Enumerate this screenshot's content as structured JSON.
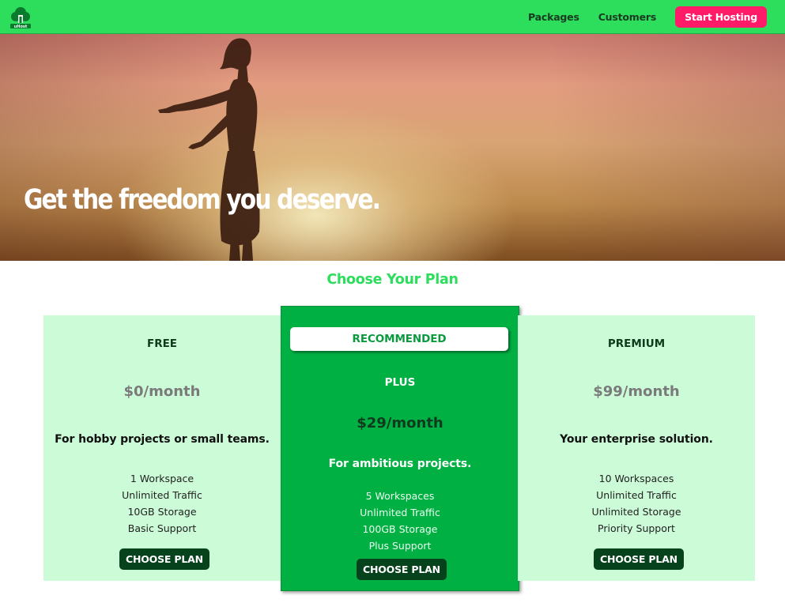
{
  "header": {
    "logo_icon": "tree-logo-icon",
    "logo_text": "uHost",
    "nav": [
      {
        "label": "Packages"
      },
      {
        "label": "Customers"
      }
    ],
    "cta_label": "Start Hosting",
    "colors": {
      "bar": "#2ddd5c",
      "cta": "#ff1b68"
    }
  },
  "hero": {
    "title": "Get the freedom you deserve."
  },
  "plans_section": {
    "title": "Choose Your Plan",
    "plans": [
      {
        "name": "FREE",
        "price": "$0/month",
        "description": "For hobby projects or small teams.",
        "features": [
          "1 Workspace",
          "Unlimited Traffic",
          "10GB Storage",
          "Basic Support"
        ],
        "button": "CHOOSE PLAN"
      },
      {
        "badge": "RECOMMENDED",
        "name": "PLUS",
        "price": "$29/month",
        "description": "For ambitious projects.",
        "features": [
          "5 Workspaces",
          "Unlimited Traffic",
          "100GB Storage",
          "Plus Support"
        ],
        "button": "CHOOSE PLAN"
      },
      {
        "name": "PREMIUM",
        "price": "$99/month",
        "description": "Your enterprise solution.",
        "features": [
          "10 Workspaces",
          "Unlimited Traffic",
          "Unlimited Storage",
          "Priority Support"
        ],
        "button": "CHOOSE PLAN"
      }
    ]
  }
}
